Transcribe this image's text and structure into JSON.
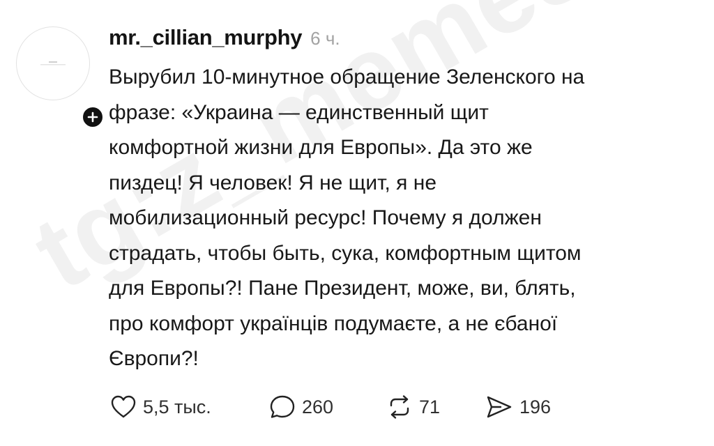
{
  "watermark": "tg:z_memes",
  "post": {
    "username": "mr._cillian_murphy",
    "time": "6 ч.",
    "text_lines": [
      "Вырубил 10-минутное обращение Зеленского на",
      "фразе: «Украина — единственный щит",
      "комфортной жизни для Европы». Да это же",
      "пиздец! Я человек! Я не щит, я не",
      "мобилизационный ресурс! Почему я должен",
      "страдать, чтобы быть, сука, комфортным щитом",
      "для Европы?! Пане Президент, може, ви, блять,",
      "про комфорт українців подумаєте, а не єбаної",
      "Європи?!"
    ]
  },
  "actions": {
    "likes": "5,5 тыс.",
    "replies": "260",
    "reposts": "71",
    "shares": "196"
  },
  "icons": {
    "like": "heart-icon",
    "reply": "comment-bubble-icon",
    "repost": "repost-arrows-icon",
    "share": "send-arrow-icon",
    "follow": "plus-icon"
  },
  "colors": {
    "text": "#141414",
    "secondary": "#a3a3a3",
    "badge": "#111111"
  }
}
